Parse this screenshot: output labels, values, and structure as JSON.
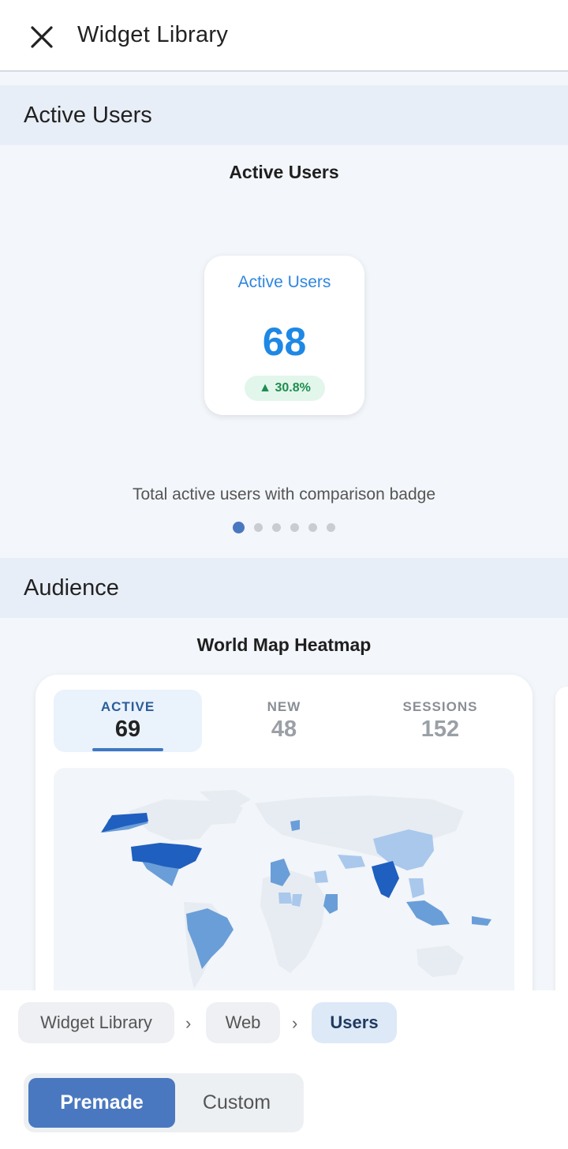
{
  "header": {
    "title": "Widget Library",
    "close_icon": "close-icon"
  },
  "sections": [
    {
      "label": "Active Users"
    },
    {
      "label": "Audience"
    }
  ],
  "widget1": {
    "title": "Active Users",
    "card_label": "Active Users",
    "value": "68",
    "badge": "▲ 30.8%",
    "description": "Total active users with comparison badge",
    "page_count": 6,
    "current_page": 1
  },
  "widget2": {
    "title": "World Map Heatmap",
    "tabs": [
      {
        "label": "ACTIVE",
        "value": "69"
      },
      {
        "label": "NEW",
        "value": "48"
      },
      {
        "label": "SESSIONS",
        "value": "152"
      }
    ],
    "active_tab": 0
  },
  "breadcrumb": {
    "items": [
      "Widget Library",
      "Web",
      "Users"
    ],
    "separator": "›"
  },
  "segmented": {
    "premade": "Premade",
    "custom": "Custom"
  },
  "colors": {
    "accent": "#4a78c0",
    "value_blue": "#1e88e5",
    "badge_green": "#1e8e4e",
    "map_dark": "#1f5fbf",
    "map_mid": "#6a9ed8",
    "map_light": "#a9c8ec"
  }
}
